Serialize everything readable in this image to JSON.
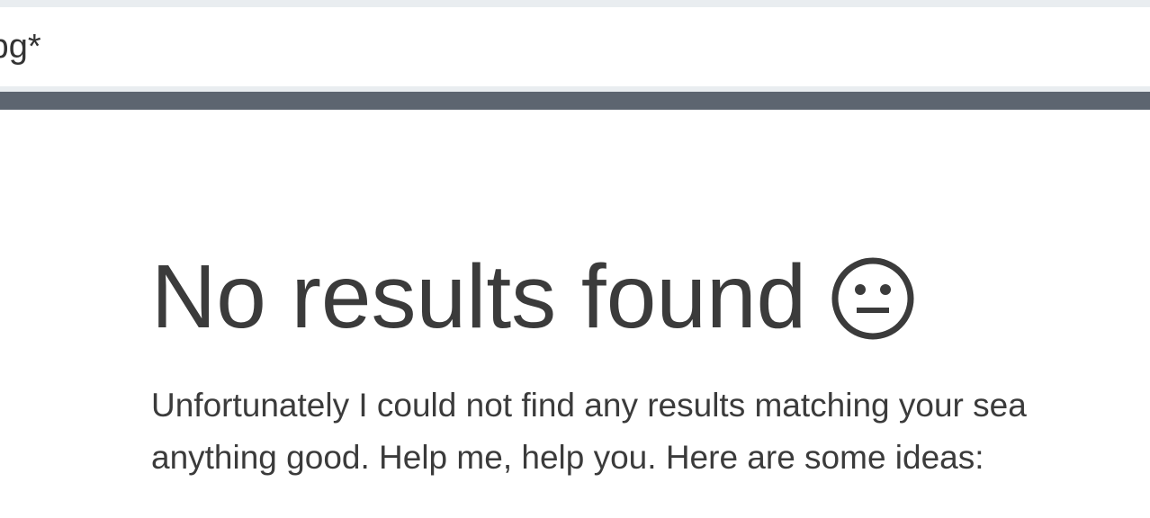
{
  "search": {
    "value": "/pg*"
  },
  "result": {
    "title": "No results found",
    "face_icon": "neutral-face-icon",
    "message_line1": "Unfortunately I could not find any results matching your sea",
    "message_line2": "anything good. Help me, help you. Here are some ideas:"
  },
  "colors": {
    "divider": "#5d6570",
    "strip": "#e9edf0",
    "text": "#3b3b3b"
  }
}
